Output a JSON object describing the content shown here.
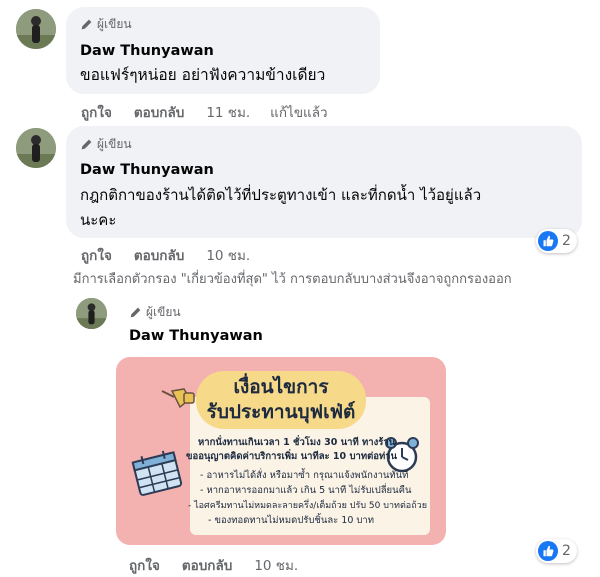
{
  "comments": [
    {
      "badge": "ผู้เขียน",
      "name": "Daw Thunyawan",
      "text_lines": [
        "ขอแฟร์ๆหน่อย อย่าฟังความข้างเดียว"
      ],
      "like": "ถูกใจ",
      "reply": "ตอบกลับ",
      "time": "11 ชม.",
      "edited": "แก้ไขแล้ว"
    },
    {
      "badge": "ผู้เขียน",
      "name": "Daw Thunyawan",
      "text_lines": [
        "กฎกติกาของร้านได้ติดไว้ที่ประตูทางเข้า และที่กดน้ำ ไว้อยู่แล้ว",
        "นะคะ"
      ],
      "like": "ถูกใจ",
      "reply": "ตอบกลับ",
      "time": "10 ชม.",
      "reactions": "2"
    }
  ],
  "filter_note": "มีการเลือกตัวกรอง \"เกี่ยวข้องที่สุด\" ไว้ การตอบกลับบางส่วนจึงอาจถูกกรองออก",
  "reply_comment": {
    "badge": "ผู้เขียน",
    "name": "Daw Thunyawan",
    "like": "ถูกใจ",
    "reply": "ตอบกลับ",
    "time": "10 ชม.",
    "reactions": "2",
    "image": {
      "title_line1": "เงื่อนไขการ",
      "title_line2": "รับประทานบุฟเฟ่ต์",
      "line1": "หากนั่งทานเกินเวลา 1 ชั่วโมง 30 นาที ทางร้าน",
      "line2": "ขออนุญาตคิดค่าบริการเพิ่ม นาทีละ 10 บาทต่อท่าน",
      "bullets": [
        "- อาหารไม่ได้สั่ง หรือมาซ้ำ กรุณาแจ้งพนักงานทันที",
        "- หากอาหารออกมาแล้ว เกิน 5 นาที ไม่รับเปลี่ยนคืน",
        "- ไอศครีมทานไม่หมดละลายครึ่ง/เต็มถ้วย ปรับ 50 บาทต่อถ้วย",
        "- ของทอดทานไม่หมดปรับชิ้นละ 10 บาท"
      ]
    }
  },
  "icons": [
    "pencil-icon",
    "like-icon",
    "pin-icon",
    "calendar-icon",
    "alarm-clock-icon"
  ],
  "colors": {
    "bubble": "#f0f2f5",
    "like_blue": "#1877f2",
    "card_bg": "#f3b1b0",
    "meta_gray": "#65676b"
  }
}
